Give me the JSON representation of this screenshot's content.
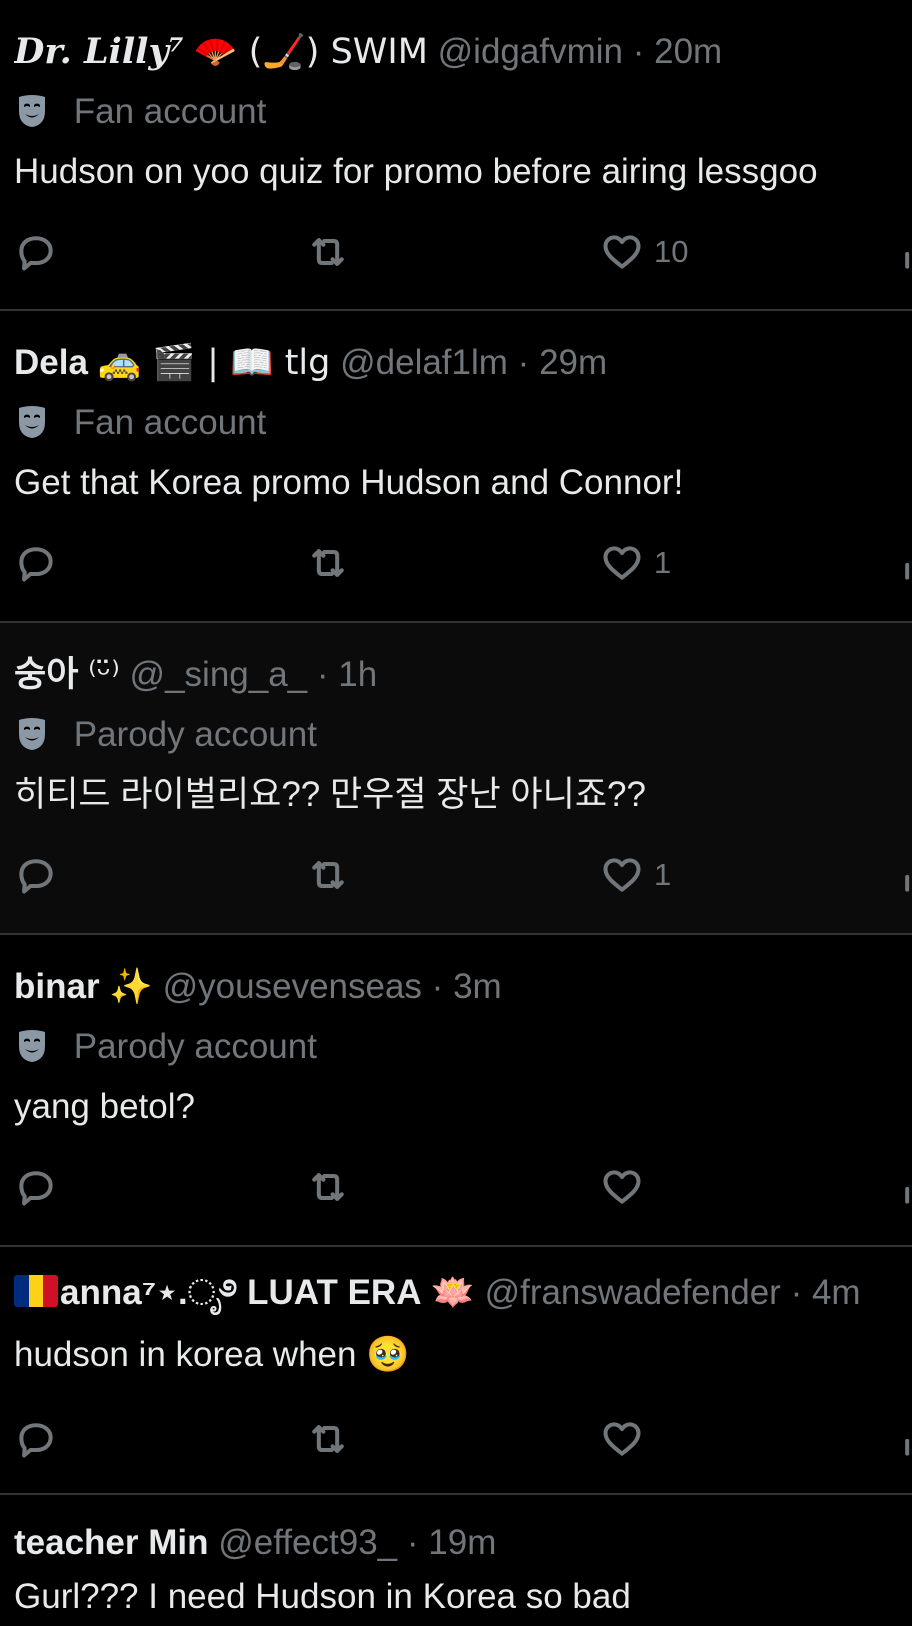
{
  "colors": {
    "background": "#000000",
    "highlight_background": "#0b0b0c",
    "primary_text": "#e7e9ea",
    "secondary_text": "#71767b",
    "divider": "#2f3336"
  },
  "tweets": [
    {
      "name": "Dr. Lilly⁷",
      "name_decor": "🪭 (🏒) SWIM",
      "handle": "@idgafvmin",
      "separator": "·",
      "time": "20m",
      "account_label": "Fan account",
      "account_icon": "theater-mask-icon",
      "text": "Hudson on yoo quiz for promo before airing lessgoo",
      "likes": "10"
    },
    {
      "name": "Dela",
      "name_decor": "🚕 🎬 | 📖 tlg",
      "handle": "@delaf1lm",
      "separator": "·",
      "time": "29m",
      "account_label": "Fan account",
      "account_icon": "theater-mask-icon",
      "text": "Get that Korea promo Hudson and Connor!",
      "likes": "1"
    },
    {
      "name": "숭아",
      "name_decor": "⁽ᵕ̈⁾",
      "handle": "@_sing_a_",
      "separator": "·",
      "time": "1h",
      "account_label": "Parody account",
      "account_icon": "theater-mask-icon",
      "text": "히티드 라이벌리요?? 만우절 장난 아니죠??",
      "likes": "1"
    },
    {
      "name": "binar",
      "name_decor": "✨",
      "handle": "@yousevenseas",
      "separator": "·",
      "time": "3m",
      "account_label": "Parody account",
      "account_icon": "theater-mask-icon",
      "text": "yang betol?",
      "likes": ""
    },
    {
      "name": "anna⁷⋆.ೃ࿔ LUAT ERA",
      "name_decor": "🪷",
      "flag_icon": "romania-flag-icon",
      "handle": "@franswadefender",
      "separator": "·",
      "time": "4m",
      "text": "hudson in korea when 🥹",
      "likes": ""
    },
    {
      "name": "teacher Min",
      "handle": "@effect93_",
      "separator": "·",
      "time": "19m",
      "text": "Gurl??? I need Hudson in Korea so bad"
    }
  ],
  "actions": {
    "reply_icon": "reply-icon",
    "retweet_icon": "retweet-icon",
    "like_icon": "heart-icon",
    "views_icon": "views-icon"
  }
}
